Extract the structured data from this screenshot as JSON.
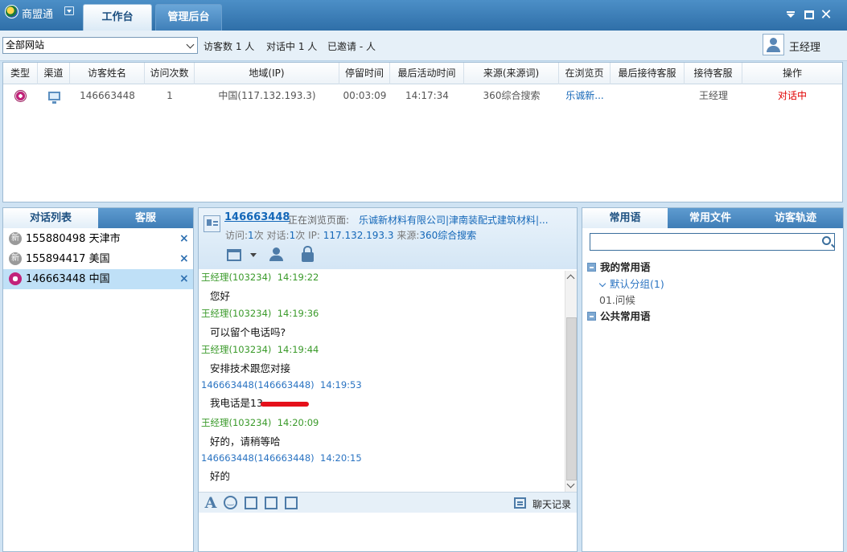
{
  "app": {
    "name": "商盟通"
  },
  "top_tabs": [
    "工作台",
    "管理后台"
  ],
  "toolbar": {
    "site_select": "全部网站",
    "visitors_stat": "访客数 1 人",
    "chatting_stat": "对话中 1 人",
    "invited_stat": "已邀请 - 人",
    "user_name": "王经理"
  },
  "visitor_table": {
    "columns": [
      "类型",
      "渠道",
      "访客姓名",
      "访问次数",
      "地域(IP)",
      "停留时间",
      "最后活动时间",
      "来源(来源词)",
      "在浏览页",
      "最后接待客服",
      "接待客服",
      "操作"
    ],
    "rows": [
      {
        "type_icon": "eye-icon",
        "channel_icon": "monitor-icon",
        "name": "146663448",
        "visits": "1",
        "region": "中国(117.132.193.3)",
        "duration": "00:03:09",
        "last_active": "14:17:34",
        "source": "360综合搜索",
        "browsing": "乐诚新...",
        "last_agent": "",
        "agent": "王经理",
        "action": "对话中"
      }
    ]
  },
  "left_panel": {
    "tabs": [
      "对话列表",
      "客服"
    ],
    "conversations": [
      {
        "badge": "新",
        "text": "155880498 天津市",
        "close": "×",
        "selected": false
      },
      {
        "badge": "新",
        "text": "155894417 美国",
        "close": "×",
        "selected": false
      },
      {
        "badge": "",
        "text": "146663448 中国",
        "close": "×",
        "selected": true
      }
    ]
  },
  "chat": {
    "visitor_id": "146663448",
    "browsing_label": "正在浏览页面:",
    "browsing_page": "乐诚新材料有限公司|津南装配式建筑材料|...",
    "info": {
      "visit_label": "访问:",
      "visit_value": "1",
      "visit_unit": "次",
      "chat_label": "对话:",
      "chat_value": "1",
      "chat_unit": "次",
      "ip_label": "IP:",
      "ip_value": "117.132.193.3",
      "source_label": "来源:",
      "source_value": "360综合搜索"
    },
    "messages": [
      {
        "sender": "王经理(103234)",
        "time": "14:19:22",
        "text": "您好",
        "role": "agent"
      },
      {
        "sender": "王经理(103234)",
        "time": "14:19:36",
        "text": "可以留个电话吗?",
        "role": "agent"
      },
      {
        "sender": "王经理(103234)",
        "time": "14:19:44",
        "text": "安排技术跟您对接",
        "role": "agent"
      },
      {
        "sender": "146663448(146663448)",
        "time": "14:19:53",
        "text": "我电话是13",
        "role": "visitor",
        "redacted": true
      },
      {
        "sender": "王经理(103234)",
        "time": "14:20:09",
        "text": "好的，请稍等哈",
        "role": "agent"
      },
      {
        "sender": "146663448(146663448)",
        "time": "14:20:15",
        "text": "好的",
        "role": "visitor"
      }
    ],
    "history_label": "聊天记录"
  },
  "right_panel": {
    "tabs": [
      "常用语",
      "常用文件",
      "访客轨迹"
    ],
    "search_placeholder": "",
    "tree": {
      "my_group": "我的常用语",
      "default_group": "默认分组(1)",
      "item": "01.问候",
      "public_group": "公共常用语"
    }
  },
  "colors": {
    "accent": "#3f7db6",
    "agent": "#3a9a2a",
    "visitor": "#2b74c2",
    "status_red": "#e00000"
  }
}
